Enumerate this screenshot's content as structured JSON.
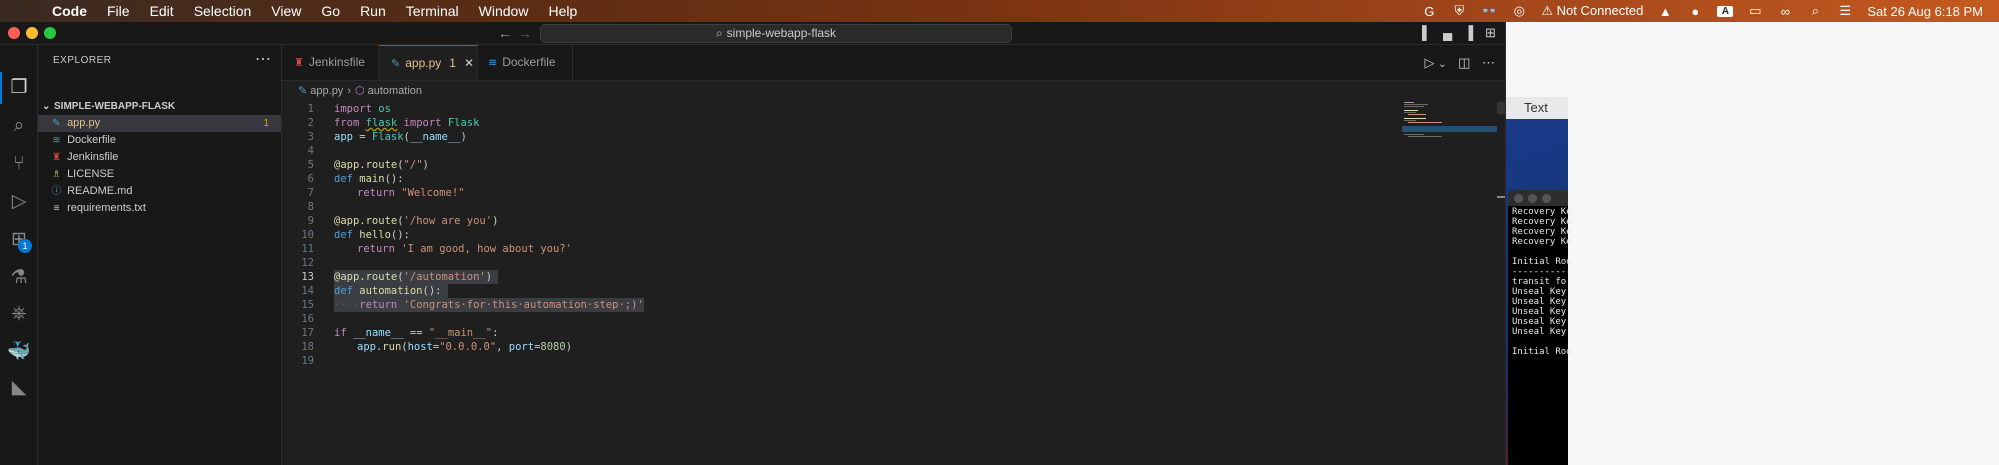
{
  "menubar": {
    "items": [
      "Code",
      "File",
      "Edit",
      "Selection",
      "View",
      "Go",
      "Run",
      "Terminal",
      "Window",
      "Help"
    ],
    "status": {
      "network": "Not Connected",
      "datetime": "Sat 26 Aug  6:18 PM",
      "input_source": "A"
    }
  },
  "window": {
    "search": "simple-webapp-flask"
  },
  "activity": {
    "extensions_badge": "1"
  },
  "explorer": {
    "title": "EXPLORER",
    "folder": "SIMPLE-WEBAPP-FLASK",
    "files": [
      {
        "name": "app.py",
        "icon": "python-file-icon",
        "problems": "1",
        "selected": true
      },
      {
        "name": "Dockerfile",
        "icon": "docker-file-icon"
      },
      {
        "name": "Jenkinsfile",
        "icon": "jenkins-file-icon"
      },
      {
        "name": "LICENSE",
        "icon": "license-file-icon"
      },
      {
        "name": "README.md",
        "icon": "info-file-icon"
      },
      {
        "name": "requirements.txt",
        "icon": "text-file-icon"
      }
    ]
  },
  "tabs": [
    {
      "label": "Jenkinsfile",
      "icon": "jenkins-file-icon"
    },
    {
      "label": "app.py",
      "icon": "python-file-icon",
      "problems": "1",
      "active": true
    },
    {
      "label": "Dockerfile",
      "icon": "docker-file-icon"
    }
  ],
  "breadcrumb": {
    "file": "app.py",
    "symbol": "automation"
  },
  "code": {
    "line_numbers": [
      "1",
      "2",
      "3",
      "4",
      "5",
      "6",
      "7",
      "8",
      "9",
      "10",
      "11",
      "12",
      "13",
      "14",
      "15",
      "16",
      "17",
      "18",
      "19"
    ],
    "current_line": "13",
    "l1_kw": "import",
    "l1_mod": " os",
    "l2_from": "from",
    "l2_mod": "flask",
    "l2_import": " import",
    "l2_cls": " Flask",
    "l3_a": "app",
    "l3_b": " = ",
    "l3_c": "Flask",
    "l3_d": "(",
    "l3_e": "__name__",
    "l3_f": ")",
    "l5_a": "@app.route",
    "l5_b": "(",
    "l5_c": "\"/\"",
    "l5_d": ")",
    "l6_a": "def",
    "l6_b": " main",
    "l6_c": "():",
    "l7_a": "return",
    "l7_b": " \"Welcome!\"",
    "l9_a": "@app.route",
    "l9_b": "(",
    "l9_c": "'/how are you'",
    "l9_d": ")",
    "l10_a": "def",
    "l10_b": " hello",
    "l10_c": "():",
    "l11_a": "return",
    "l11_b": " 'I am good, how about you?'",
    "l13_a": "@app.route",
    "l13_b": "(",
    "l13_c": "'/automation'",
    "l13_d": ")",
    "l14_a": "def",
    "l14_b": " automation",
    "l14_c": "():",
    "l15_ws": "····",
    "l15_a": "return",
    "l15_b": " 'Congrats·for·this·automation·step·;)'",
    "l17_a": "if",
    "l17_b": " __name__",
    "l17_c": " == ",
    "l17_d": "\"__main__\"",
    "l17_e": ":",
    "l18_a": "app",
    "l18_b": ".",
    "l18_c": "run",
    "l18_d": "(",
    "l18_e": "host",
    "l18_f": "=",
    "l18_g": "\"0.0.0.0\"",
    "l18_h": ", ",
    "l18_i": "port",
    "l18_j": "=",
    "l18_k": "8080",
    "l18_l": ")"
  },
  "rightapp": {
    "title": "Text"
  },
  "terminal": {
    "lines": [
      "Recovery Ke",
      "Recovery Ke",
      "Recovery Ke",
      "Recovery Ke",
      "",
      "Initial Roo",
      "-----------",
      "transit fo",
      "Unseal Key",
      "Unseal Key",
      "Unseal Key",
      "Unseal Key",
      "Unseal Key",
      "",
      "Initial Roo"
    ]
  },
  "colors": {
    "accent": "#0078d4",
    "warning": "#cca700",
    "modified_tab": "#e2c08d"
  }
}
